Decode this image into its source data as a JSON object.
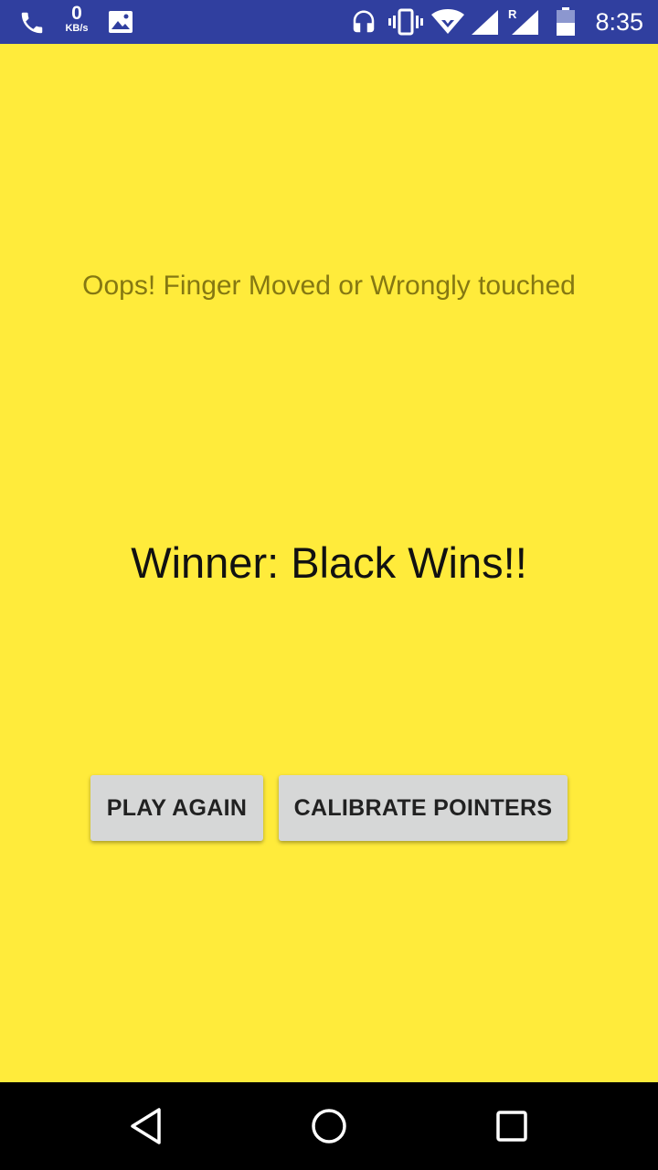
{
  "status_bar": {
    "icons": [
      "phone-icon",
      "image-icon",
      "headset-icon",
      "vibrate-icon",
      "wifi-icon",
      "signal-icon",
      "roaming-signal-icon",
      "battery-icon"
    ],
    "net_speed_value": "0",
    "net_speed_unit": "KB/s",
    "roaming_label": "R",
    "time": "8:35",
    "background_color": "#303f9f"
  },
  "main": {
    "background_color": "#ffeb3b",
    "message": "Oops! Finger Moved or Wrongly touched",
    "winner_text": "Winner: Black Wins!!",
    "buttons": {
      "play_again": "PLAY AGAIN",
      "calibrate_pointers": "CALIBRATE POINTERS"
    }
  },
  "nav_bar": {
    "icons": [
      "back-icon",
      "home-icon",
      "recents-icon"
    ]
  }
}
